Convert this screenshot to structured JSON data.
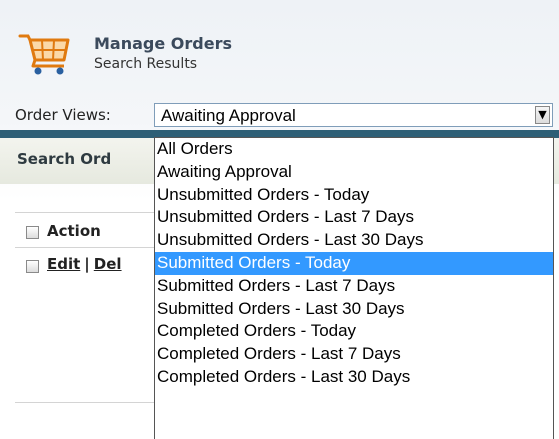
{
  "header": {
    "title": "Manage Orders",
    "subtitle": "Search Results",
    "icon": "shopping-cart-icon"
  },
  "order_views": {
    "label": "Order Views:",
    "selected_value": "Awaiting Approval",
    "options": [
      "All Orders",
      "Awaiting Approval",
      "Unsubmitted Orders - Today",
      "Unsubmitted Orders - Last 7 Days",
      "Unsubmitted Orders - Last 30 Days",
      "Submitted Orders - Today",
      "Submitted Orders - Last 7 Days",
      "Submitted Orders - Last 30 Days",
      "Completed Orders - Today",
      "Completed Orders - Last 7 Days",
      "Completed Orders - Last 30 Days"
    ],
    "highlighted_option": "Submitted Orders - Today"
  },
  "search_tab": {
    "label": "Search Ord"
  },
  "table": {
    "header_action": "Action",
    "row_edit": "Edit",
    "row_separator": "|",
    "row_delete": "Del"
  },
  "colors": {
    "accent_bar": "#2e5f76",
    "highlight": "#3399ff",
    "cart_icon": "#f08a1c"
  }
}
